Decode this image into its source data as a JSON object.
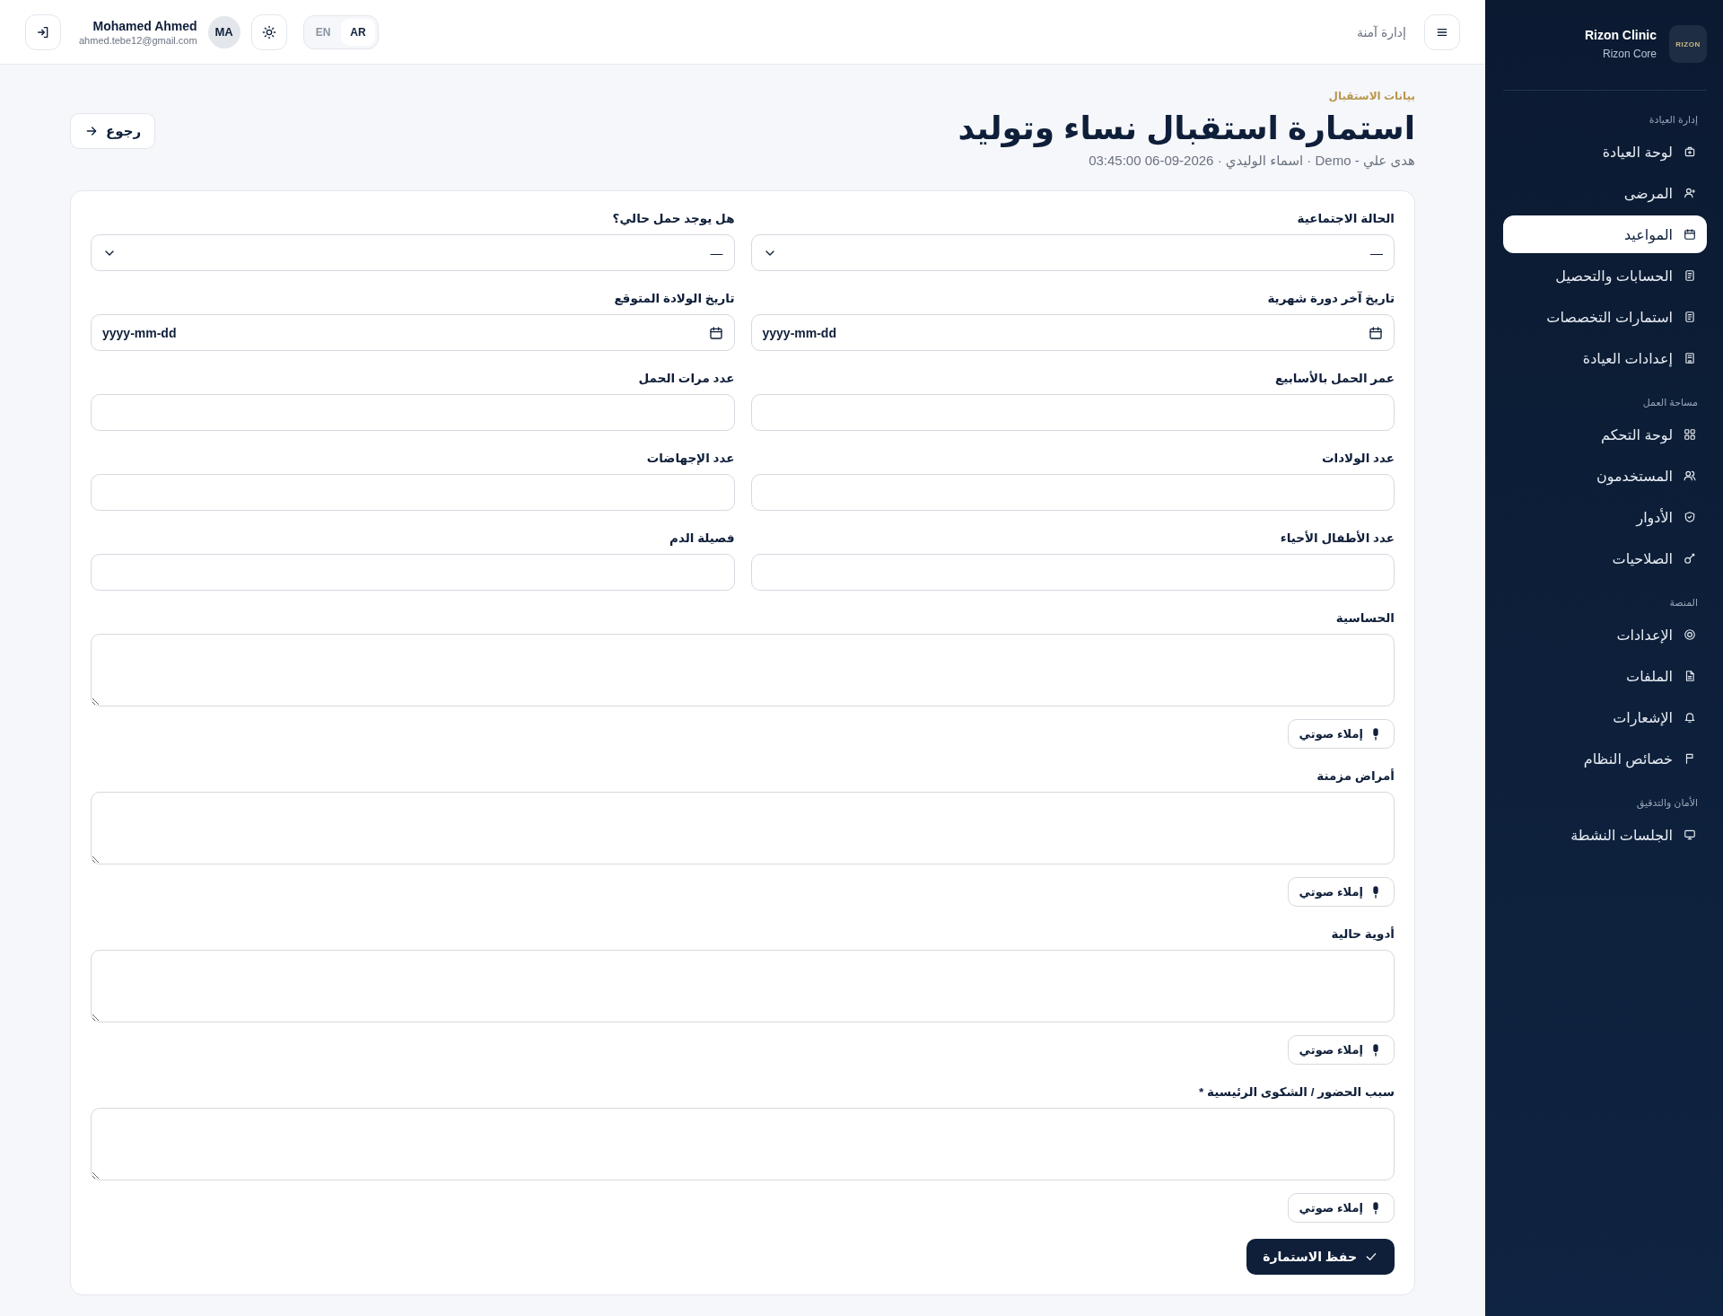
{
  "topbar": {
    "section_title": "إدارة آمنة",
    "languages": [
      {
        "label": "AR",
        "selected": true
      },
      {
        "label": "EN",
        "selected": false
      }
    ],
    "user": {
      "initials": "MA",
      "name": "Mohamed Ahmed",
      "email": "ahmed.tebe12@gmail.com"
    }
  },
  "sidebar": {
    "brand": {
      "name": "Rizon Clinic",
      "subtitle": "Rizon Core",
      "logo_text": "RIZON"
    },
    "sections": [
      {
        "title": "إدارة العيادة",
        "items": [
          {
            "label": "لوحة العيادة",
            "selected": false
          },
          {
            "label": "المرضى",
            "selected": false
          },
          {
            "label": "المواعيد",
            "selected": true
          },
          {
            "label": "الحسابات والتحصيل",
            "selected": false
          },
          {
            "label": "استمارات التخصصات",
            "selected": false
          },
          {
            "label": "إعدادات العيادة",
            "selected": false
          }
        ]
      },
      {
        "title": "مساحة العمل",
        "items": [
          {
            "label": "لوحة التحكم",
            "selected": false
          },
          {
            "label": "المستخدمون",
            "selected": false
          },
          {
            "label": "الأدوار",
            "selected": false
          },
          {
            "label": "الصلاحيات",
            "selected": false
          }
        ]
      },
      {
        "title": "المنصة",
        "items": [
          {
            "label": "الإعدادات",
            "selected": false
          },
          {
            "label": "الملفات",
            "selected": false
          },
          {
            "label": "الإشعارات",
            "selected": false
          },
          {
            "label": "خصائص النظام",
            "selected": false
          }
        ]
      },
      {
        "title": "الأمان والتدقيق",
        "items": [
          {
            "label": "الجلسات النشطة",
            "selected": false
          }
        ]
      }
    ]
  },
  "page": {
    "eyebrow": "بيانات الاستقبال",
    "title": "استمارة استقبال نساء وتوليد",
    "subtitle": "هدى علي - Demo · اسماء الوليدي · 2026-09-06 03:45:00",
    "back_button": "رجوع"
  },
  "form": {
    "fields": [
      {
        "kind": "select",
        "label": "الحالة الاجتماعية",
        "value": "—"
      },
      {
        "kind": "select",
        "label": "هل يوجد حمل حالي؟",
        "value": "—"
      },
      {
        "kind": "date",
        "label": "تاريخ آخر دورة شهرية",
        "placeholder": "yyyy-mm-dd"
      },
      {
        "kind": "date",
        "label": "تاريخ الولادة المتوقع",
        "placeholder": "yyyy-mm-dd"
      },
      {
        "kind": "text",
        "label": "عمر الحمل بالأسابيع"
      },
      {
        "kind": "text",
        "label": "عدد مرات الحمل"
      },
      {
        "kind": "text",
        "label": "عدد الولادات"
      },
      {
        "kind": "text",
        "label": "عدد الإجهاضات"
      },
      {
        "kind": "text",
        "label": "عدد الأطفال الأحياء"
      },
      {
        "kind": "text",
        "label": "فصيلة الدم"
      }
    ],
    "textareas": [
      {
        "label": "الحساسية",
        "dictation_button": "إملاء صوتي"
      },
      {
        "label": "أمراض مزمنة",
        "dictation_button": "إملاء صوتي"
      },
      {
        "label": "أدوية حالية",
        "dictation_button": "إملاء صوتي"
      },
      {
        "label": "سبب الحضور / الشكوى الرئيسية *",
        "dictation_button": "إملاء صوتي"
      }
    ],
    "submit_button": "حفظ الاستمارة"
  }
}
